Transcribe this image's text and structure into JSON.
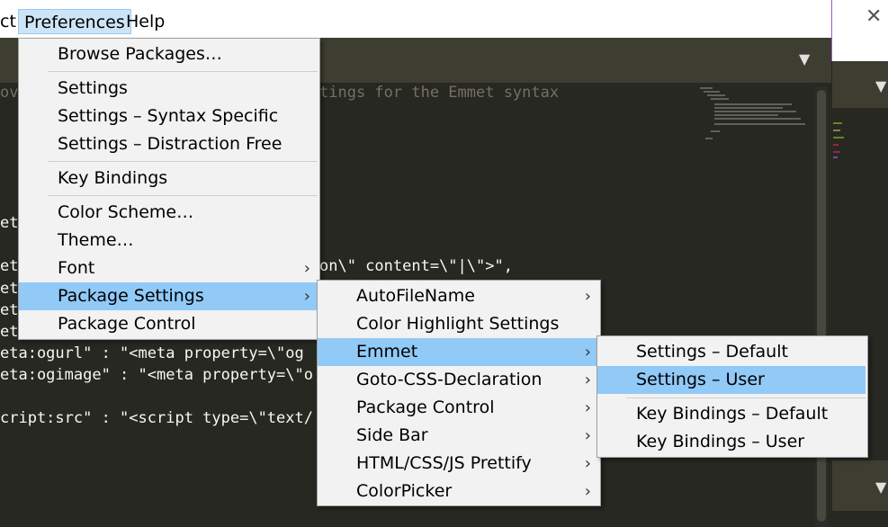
{
  "menubar": {
    "items": [
      {
        "label": "ct"
      },
      {
        "label": "Preferences"
      },
      {
        "label": "Help"
      }
    ],
    "close_glyph": "✕"
  },
  "editor": {
    "lines": [
      {
        "text": "ove",
        "style": "comment"
      },
      {
        "text": "tings for the Emmet syntax",
        "style": "comment"
      },
      {
        "text": "ets",
        "style": "code"
      },
      {
        "text": "eta",
        "style": "code"
      },
      {
        "text": "on\\\" content=\\\"|\\\">\",",
        "style": "code"
      },
      {
        "text": "eta",
        "style": "code"
      },
      {
        "text": "eta",
        "style": "code"
      },
      {
        "text": "eta",
        "style": "code"
      },
      {
        "text": "eta:ogurl\" : \"<meta property=\\\"og",
        "style": "code"
      },
      {
        "text": "eta:ogimage\" : \"<meta property=\\\"o",
        "style": "code"
      },
      {
        "text": "cript:src\" : \"<script type=\\\"text/",
        "style": "code"
      }
    ]
  },
  "menus": {
    "preferences": {
      "items": [
        {
          "label": "Browse Packages…"
        },
        {
          "label": "Settings"
        },
        {
          "label": "Settings – Syntax Specific"
        },
        {
          "label": "Settings – Distraction Free"
        },
        {
          "label": "Key Bindings"
        },
        {
          "label": "Color Scheme…"
        },
        {
          "label": "Theme…"
        },
        {
          "label": "Font",
          "arrow": "›"
        },
        {
          "label": "Package Settings",
          "arrow": "›"
        },
        {
          "label": "Package Control"
        }
      ]
    },
    "package_settings": {
      "items": [
        {
          "label": "AutoFileName",
          "arrow": "›"
        },
        {
          "label": "Color Highlight Settings"
        },
        {
          "label": "Emmet",
          "arrow": "›"
        },
        {
          "label": "Goto-CSS-Declaration",
          "arrow": "›"
        },
        {
          "label": "Package Control",
          "arrow": "›"
        },
        {
          "label": "Side Bar",
          "arrow": "›"
        },
        {
          "label": "HTML/CSS/JS Prettify",
          "arrow": "›"
        },
        {
          "label": "ColorPicker",
          "arrow": "›"
        }
      ]
    },
    "emmet": {
      "items": [
        {
          "label": "Settings – Default"
        },
        {
          "label": "Settings – User"
        },
        {
          "label": "Key Bindings – Default"
        },
        {
          "label": "Key Bindings – User"
        }
      ]
    }
  },
  "icons": {
    "tab_dropdown": "▼"
  },
  "colors": {
    "menu_highlight": "#91c9f7",
    "editor_bg": "#272822",
    "comment": "#75715e"
  }
}
